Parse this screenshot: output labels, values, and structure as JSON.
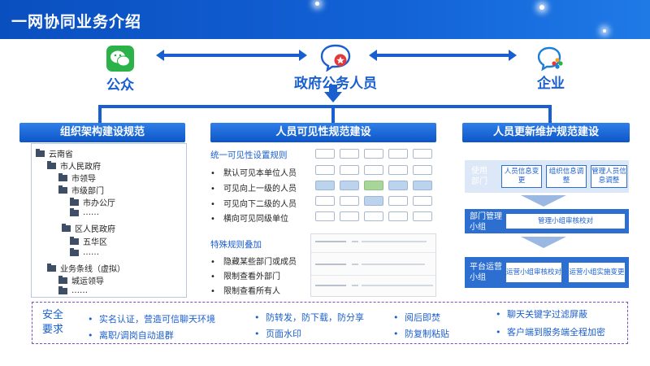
{
  "header": {
    "title": "一网协同业务介绍"
  },
  "actors": {
    "public": {
      "label": "公众",
      "icon": "wechat-icon"
    },
    "government": {
      "label": "政府公务人员",
      "icon": "gov-chat-icon"
    },
    "enterprise": {
      "label": "企业",
      "icon": "enterprise-chat-icon"
    }
  },
  "sections": {
    "org": {
      "title": "组织架构建设规范",
      "tree": [
        {
          "label": "云南省",
          "level": 0
        },
        {
          "label": "市人民政府",
          "level": 1
        },
        {
          "label": "市领导",
          "level": 2
        },
        {
          "label": "市级部门",
          "level": 2
        },
        {
          "label": "市办公厅",
          "level": 3
        },
        {
          "label": "……",
          "level": 3
        },
        {
          "label": "区人民政府",
          "level": 2
        },
        {
          "label": "五华区",
          "level": 3
        },
        {
          "label": "……",
          "level": 3
        },
        {
          "label": "业务条线（虚拟）",
          "level": 1
        },
        {
          "label": "城运领导",
          "level": 2
        },
        {
          "label": "……",
          "level": 2
        }
      ]
    },
    "visibility": {
      "title": "人员可见性规范建设",
      "unified_title": "统一可见性设置规则",
      "unified_items": [
        "默认可见本单位人员",
        "可见向上一级的人员",
        "可见向下二级的人员",
        "横向可见同级单位"
      ],
      "special_title": "特殊规则叠加",
      "special_items": [
        "隐藏某些部门或成员",
        "限制查看外部门",
        "限制查看所有人"
      ]
    },
    "maintenance": {
      "title": "人员更新维护规范建设",
      "use_dept": "使用部门",
      "use_boxes": [
        "人员信息变更",
        "组织信息调整",
        "管理人员信息调整"
      ],
      "dept_admin": "部门管理小组",
      "dept_box": "管理小组审核校对",
      "platform_ops": "平台运营小组",
      "platform_boxes": [
        "运营小组审核校对",
        "运营小组实施变更"
      ]
    }
  },
  "security": {
    "label": "安全要求",
    "items": [
      "实名认证，营造可信聊天环境",
      "离职/调岗自动退群",
      "防转发，防下载，防分享",
      "页面水印",
      "阅后即焚",
      "防复制粘贴",
      "聊天关键字过滤屏蔽",
      "客户端到服务端全程加密"
    ]
  }
}
